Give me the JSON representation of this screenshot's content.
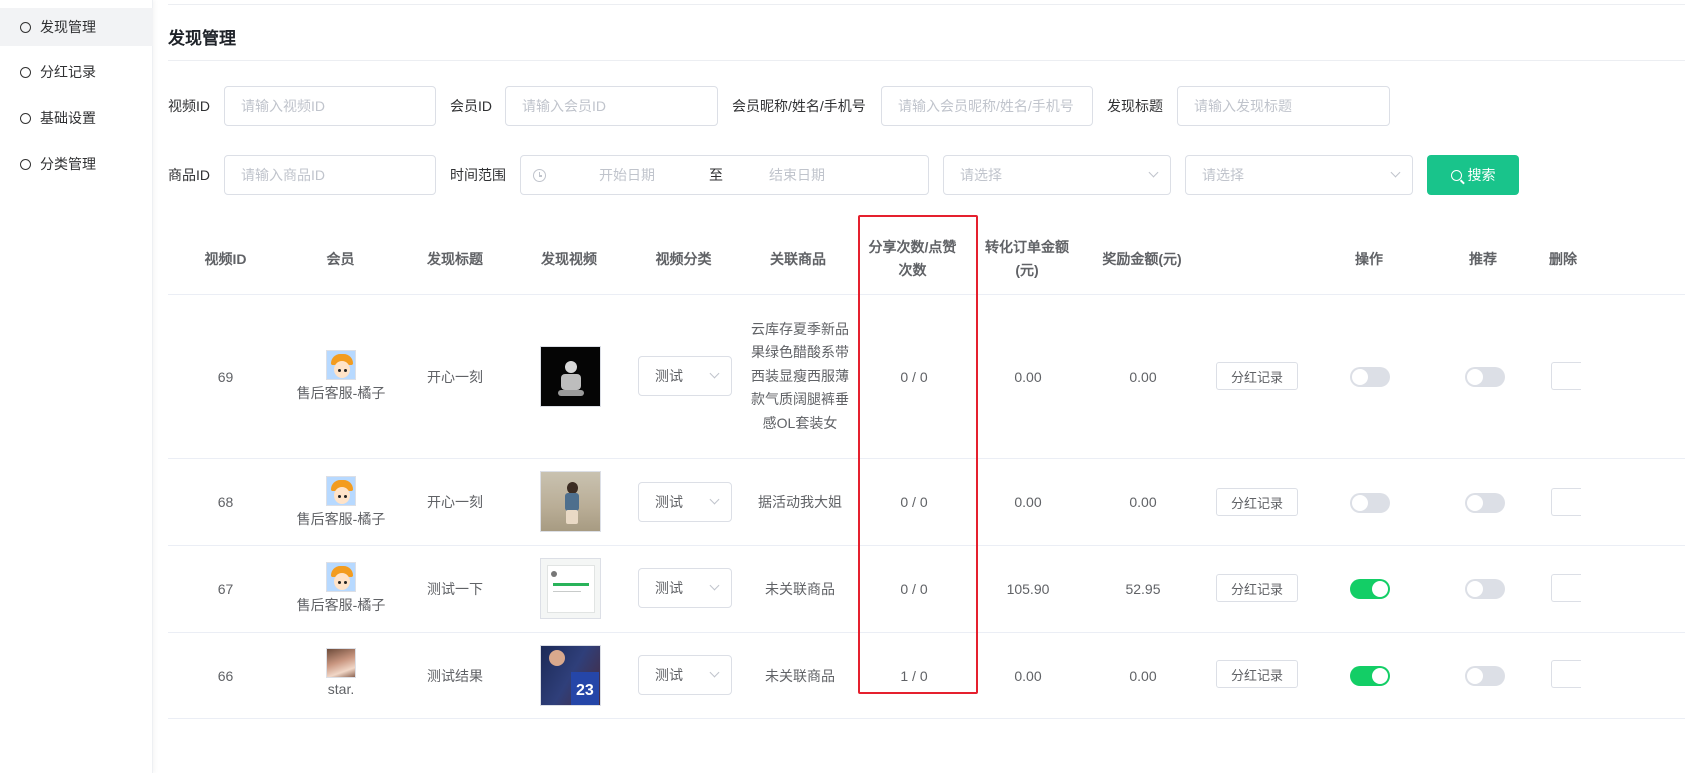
{
  "sidebar": {
    "items": [
      {
        "label": "发现管理",
        "active": true
      },
      {
        "label": "分红记录",
        "active": false
      },
      {
        "label": "基础设置",
        "active": false
      },
      {
        "label": "分类管理",
        "active": false
      }
    ]
  },
  "page": {
    "title": "发现管理"
  },
  "filters": {
    "video_id": {
      "label": "视频ID",
      "placeholder": "请输入视频ID"
    },
    "member_id": {
      "label": "会员ID",
      "placeholder": "请输入会员ID"
    },
    "member_name": {
      "label": "会员昵称/姓名/手机号",
      "placeholder": "请输入会员昵称/姓名/手机号"
    },
    "title": {
      "label": "发现标题",
      "placeholder": "请输入发现标题"
    },
    "product_id": {
      "label": "商品ID",
      "placeholder": "请输入商品ID"
    },
    "time_range": {
      "label": "时间范围",
      "start": "开始日期",
      "separator": "至",
      "end": "结束日期"
    },
    "select1": {
      "placeholder": "请选择"
    },
    "select2": {
      "placeholder": "请选择"
    },
    "search_label": "搜索"
  },
  "table": {
    "headers": {
      "video_id": "视频ID",
      "member": "会员",
      "title": "发现标题",
      "video": "发现视频",
      "category": "视频分类",
      "product": "关联商品",
      "share_like": "分享次数/点赞次数",
      "order_amount": "转化订单金额(元)",
      "reward": "奖励金额(元)",
      "operation": "操作",
      "recommend": "推荐",
      "delete_partial": "删除"
    },
    "rows": [
      {
        "video_id": "69",
        "member": "售后客服-橘子",
        "title": "开心一刻",
        "category": "测试",
        "product": "云库存夏季新品果绿色醋酸系带西装显瘦西服薄款气质阔腿裤垂感OL套装女",
        "share_like": "0 / 0",
        "order_amount": "0.00",
        "reward": "0.00",
        "record_label": "分红记录",
        "operation_on": false,
        "recommend_on": false
      },
      {
        "video_id": "68",
        "member": "售后客服-橘子",
        "title": "开心一刻",
        "category": "测试",
        "product": "据活动我大姐",
        "share_like": "0 / 0",
        "order_amount": "0.00",
        "reward": "0.00",
        "record_label": "分红记录",
        "operation_on": false,
        "recommend_on": false
      },
      {
        "video_id": "67",
        "member": "售后客服-橘子",
        "title": "测试一下",
        "category": "测试",
        "product": "未关联商品",
        "share_like": "0 / 0",
        "order_amount": "105.90",
        "reward": "52.95",
        "record_label": "分红记录",
        "operation_on": true,
        "recommend_on": false
      },
      {
        "video_id": "66",
        "member": "star.",
        "title": "测试结果",
        "category": "测试",
        "product": "未关联商品",
        "share_like": "1 / 0",
        "order_amount": "0.00",
        "reward": "0.00",
        "record_label": "分红记录",
        "operation_on": true,
        "recommend_on": false
      }
    ]
  },
  "thumb_text": "23",
  "colors": {
    "primary": "#19c48b",
    "switch_on": "#13ce66",
    "switch_off": "#dcdfe6",
    "highlight": "#e5202e"
  }
}
